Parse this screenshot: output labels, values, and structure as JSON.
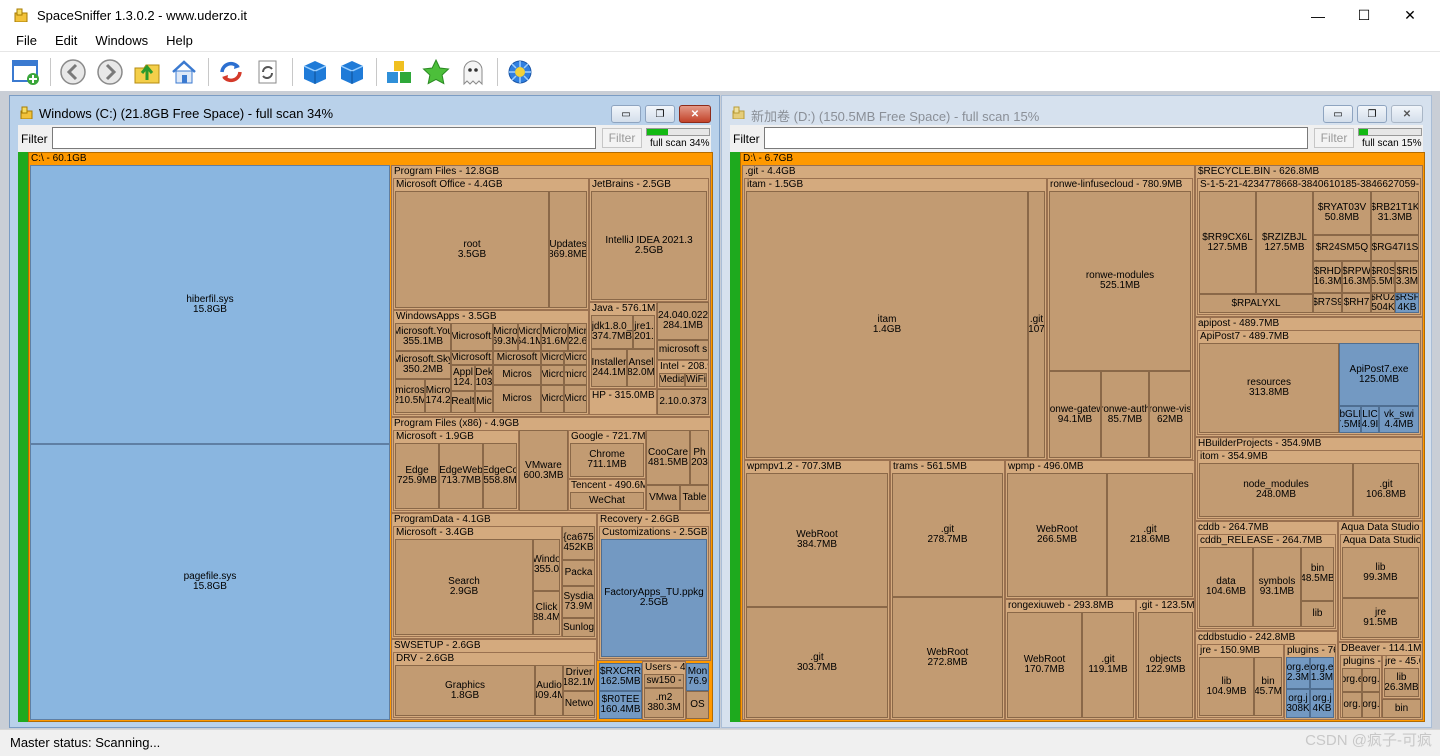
{
  "app": {
    "title": "SpaceSniffer 1.3.0.2 - www.uderzo.it",
    "window_controls": {
      "minimize": "—",
      "maximize": "☐",
      "close": "✕"
    }
  },
  "menu": [
    "File",
    "Edit",
    "Windows",
    "Help"
  ],
  "toolbar_icons": [
    "new-scan-icon",
    "back-icon",
    "forward-icon",
    "up-folder-icon",
    "home-icon",
    "refresh-icon",
    "rescan-icon",
    "blue-box-icon",
    "blue-box-2-icon",
    "color-boxes-icon",
    "star-icon",
    "ghost-icon",
    "settings-flower-icon"
  ],
  "colors": {
    "root": "#ff9900",
    "dir": "#d4aa7e",
    "file": "#c29b72",
    "scan_bar": "#1eaa1e",
    "blue_file": "#8ab6e0"
  },
  "windows": [
    {
      "title": "Windows  (C:) (21.8GB Free Space) - full scan 34%",
      "filter_label": "Filter",
      "filter_value": "",
      "filter_button": "Filter",
      "progress_label": "full scan 34%",
      "progress": 0.34,
      "root_label": "C:\\ - 60.1GB"
    },
    {
      "title": "新加卷 (D:) (150.5MB Free Space) - full scan 15%",
      "filter_label": "Filter",
      "filter_value": "",
      "filter_button": "Filter",
      "progress_label": "full scan 15%",
      "progress": 0.15,
      "root_label": "D:\\ - 6.7GB"
    }
  ],
  "status": "Master status: Scanning...",
  "watermark": "CSDN @疯子-可疯"
}
